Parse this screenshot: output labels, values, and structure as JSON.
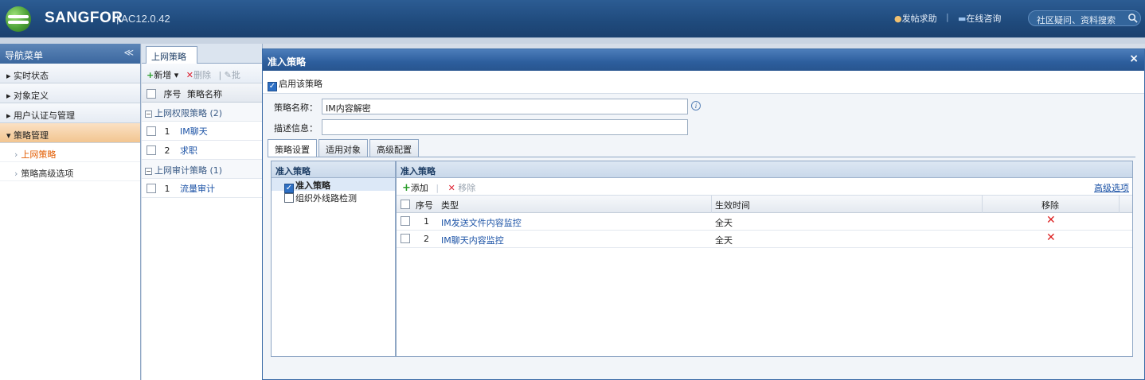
{
  "header": {
    "brand": "SANGFOR",
    "version": "AC12.0.42",
    "post_help": "发帖求助",
    "online_consult": "在线咨询",
    "search_placeholder": "社区疑问、资料搜索"
  },
  "nav": {
    "title": "导航菜单",
    "collapse": "≪",
    "items": [
      {
        "label": "▸ 实时状态"
      },
      {
        "label": "▸ 对象定义"
      },
      {
        "label": "▸ 用户认证与管理"
      },
      {
        "label": "▾ 策略管理"
      }
    ],
    "sub_items": [
      {
        "label": "上网策略"
      },
      {
        "label": "策略高级选项"
      }
    ]
  },
  "panel": {
    "tab": "上网策略",
    "toolbar": {
      "add": "新增",
      "delete": "删除",
      "batch": "批"
    },
    "columns": {
      "index": "序号",
      "name": "策略名称"
    },
    "groups": [
      {
        "title": "上网权限策略 (2)",
        "rows": [
          {
            "index": "1",
            "name": "IM聊天"
          },
          {
            "index": "2",
            "name": "求职"
          }
        ]
      },
      {
        "title": "上网审计策略 (1)",
        "rows": [
          {
            "index": "1",
            "name": "流量审计"
          }
        ]
      }
    ]
  },
  "dialog": {
    "title": "准入策略",
    "close": "×",
    "enable_label": "启用该策略",
    "name_label": "策略名称：",
    "name_value": "IM内容解密",
    "desc_label": "描述信息：",
    "desc_value": "",
    "tabs": [
      "策略设置",
      "适用对象",
      "高级配置"
    ],
    "tree": {
      "header": "准入策略",
      "items": [
        {
          "label": "准入策略",
          "checked": true
        },
        {
          "label": "组织外线路检测",
          "checked": false
        }
      ]
    },
    "grid": {
      "header": "准入策略",
      "add": "添加",
      "remove": "移除",
      "advanced": "高级选项",
      "columns": {
        "index": "序号",
        "type": "类型",
        "time": "生效时间",
        "remove": "移除"
      },
      "rows": [
        {
          "index": "1",
          "type": "IM发送文件内容监控",
          "time": "全天"
        },
        {
          "index": "2",
          "type": "IM聊天内容监控",
          "time": "全天"
        }
      ]
    }
  },
  "colors": {
    "accent": "#2d5e9d",
    "selected_nav": "#e25c00",
    "link": "#1c53a6",
    "remove": "#d22222"
  }
}
